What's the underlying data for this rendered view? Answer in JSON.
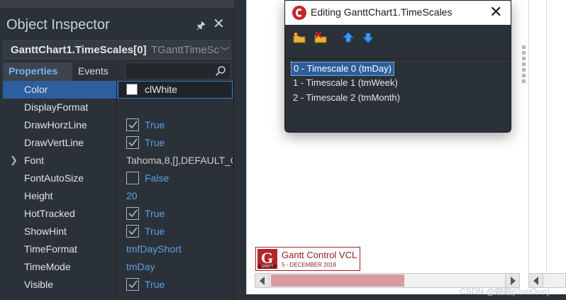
{
  "inspector": {
    "title": "Object Inspector",
    "pin_icon": "pin-icon",
    "close_icon": "close-icon",
    "selector_name": "GanttChart1.TimeScales[0]",
    "selector_type": "TGanttTimeSca",
    "tabs": [
      "Properties",
      "Events"
    ],
    "search_placeholder": "",
    "properties": [
      {
        "name": "Color",
        "value": "clWhite",
        "kind": "color"
      },
      {
        "name": "DisplayFormat",
        "value": "",
        "kind": "text"
      },
      {
        "name": "DrawHorzLine",
        "value": "True",
        "kind": "bool",
        "checked": true
      },
      {
        "name": "DrawVertLine",
        "value": "True",
        "kind": "bool",
        "checked": true
      },
      {
        "name": "Font",
        "value": "Tahoma,8,[],DEFAULT_C",
        "kind": "expand"
      },
      {
        "name": "FontAutoSize",
        "value": "False",
        "kind": "bool",
        "checked": false
      },
      {
        "name": "Height",
        "value": "20",
        "kind": "num"
      },
      {
        "name": "HotTracked",
        "value": "True",
        "kind": "bool",
        "checked": true
      },
      {
        "name": "ShowHint",
        "value": "True",
        "kind": "bool",
        "checked": true
      },
      {
        "name": "TimeFormat",
        "value": "tmfDayShort",
        "kind": "enum"
      },
      {
        "name": "TimeMode",
        "value": "tmDay",
        "kind": "enum"
      },
      {
        "name": "Visible",
        "value": "True",
        "kind": "bool",
        "checked": true
      }
    ]
  },
  "dialog": {
    "title": "Editing GanttChart1.TimeScales",
    "close": "✕",
    "items": [
      "0 - Timescale 0 (tmDay)",
      "1 - Timescale 1 (tmWeek)",
      "2 - Timescale 2 (tmMonth)"
    ],
    "selected_index": 0
  },
  "logo": {
    "mark": "G",
    "mark_sub": "GANTT",
    "title": "Gantt Control VCL",
    "date": "5 - DECEMBER 2018"
  },
  "watermark": "CSDN @蝈蝈(GuoGuo)",
  "colors": {
    "accent": "#2d5e9e",
    "value_blue": "#5aa0e8",
    "logo_red": "#b0262a",
    "scroll_thumb": "#d89a9e"
  }
}
